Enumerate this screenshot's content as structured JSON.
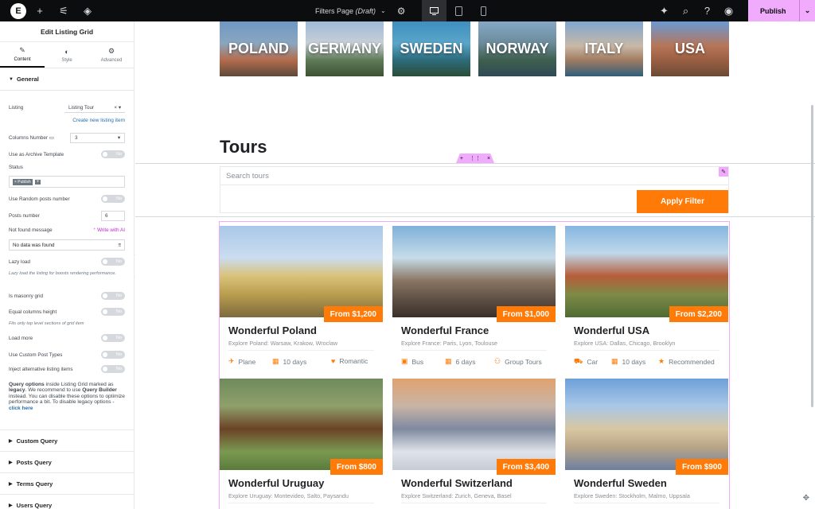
{
  "topbar": {
    "page_title": "Filters Page",
    "page_status": "(Draft)",
    "publish_label": "Publish"
  },
  "panel": {
    "title": "Edit Listing Grid",
    "tabs": [
      {
        "label": "Content",
        "icon": "pencil-icon"
      },
      {
        "label": "Style",
        "icon": "half-circle-icon"
      },
      {
        "label": "Advanced",
        "icon": "gear-icon"
      }
    ],
    "general": {
      "section_label": "General",
      "listing_label": "Listing",
      "listing_value": "Listing Tour",
      "create_new_link": "Create new listing item",
      "columns_label": "Columns Number",
      "columns_value": "3",
      "archive_label": "Use as Archive Template",
      "status_label": "Status",
      "status_tag": "× Publish",
      "random_label": "Use Random posts number",
      "posts_number_label": "Posts number",
      "posts_number_value": "6",
      "not_found_label": "Not found message",
      "write_ai_link": "Write with AI",
      "not_found_value": "No data was found",
      "lazy_label": "Lazy load",
      "lazy_hint": "Lazy load the listing for boosts rendering performance.",
      "masonry_label": "Is masonry grid",
      "equal_label": "Equal columns height",
      "equal_hint": "Fits only top level sections of grid item",
      "load_more_label": "Load more",
      "custom_post_types_label": "Use Custom Post Types",
      "inject_label": "Inject alternative listing items",
      "toggle_off": "No",
      "notice_text_1": "Query options",
      "notice_text_2": " inside Listing Grid marked as ",
      "notice_text_3": "legacy",
      "notice_text_4": ". We recommend to use ",
      "notice_text_5": "Query Builder",
      "notice_text_6": " instead. You can disable these options to optimize performance a bit. To disable legacy options - ",
      "notice_link": "click here"
    },
    "sections": [
      "Custom Query",
      "Posts Query",
      "Terms Query",
      "Users Query"
    ]
  },
  "canvas": {
    "countries": [
      "POLAND",
      "GERMANY",
      "SWEDEN",
      "NORWAY",
      "ITALY",
      "USA"
    ],
    "tours_heading": "Tours",
    "search_placeholder": "Search tours",
    "apply_button": "Apply Filter",
    "cards": [
      {
        "title": "Wonderful Poland",
        "subtitle": "Explore Poland: Warsaw, Krakow, Wroclaw",
        "price": "From $1,200",
        "transport": "Plane",
        "transport_icon": "plane-icon",
        "days": "10 days",
        "tag": "Romantic",
        "tag_icon": "heart-icon"
      },
      {
        "title": "Wonderful France",
        "subtitle": "Explore France: Paris, Lyon, Toulouse",
        "price": "From $1,000",
        "transport": "Bus",
        "transport_icon": "bus-icon",
        "days": "6 days",
        "tag": "Group Tours",
        "tag_icon": "group-icon"
      },
      {
        "title": "Wonderful USA",
        "subtitle": "Explore USA: Dallas, Chicago, Brooklyn",
        "price": "From $2,200",
        "transport": "Car",
        "transport_icon": "car-icon",
        "days": "10 days",
        "tag": "Recommended",
        "tag_icon": "star-icon"
      },
      {
        "title": "Wonderful Uruguay",
        "subtitle": "Explore Uruguay: Montevideo, Salto, Paysandu",
        "price": "From $800"
      },
      {
        "title": "Wonderful Switzerland",
        "subtitle": "Explore Switzerland: Zurich, Geneva, Basel",
        "price": "From $3,400"
      },
      {
        "title": "Wonderful Sweden",
        "subtitle": "Explore Sweden: Stockholm, Malmo, Uppsala",
        "price": "From $900"
      }
    ]
  },
  "colors": {
    "accent": "#ff7a06",
    "editor_pink": "#f0abfc",
    "topbar": "#0c0d0e"
  }
}
